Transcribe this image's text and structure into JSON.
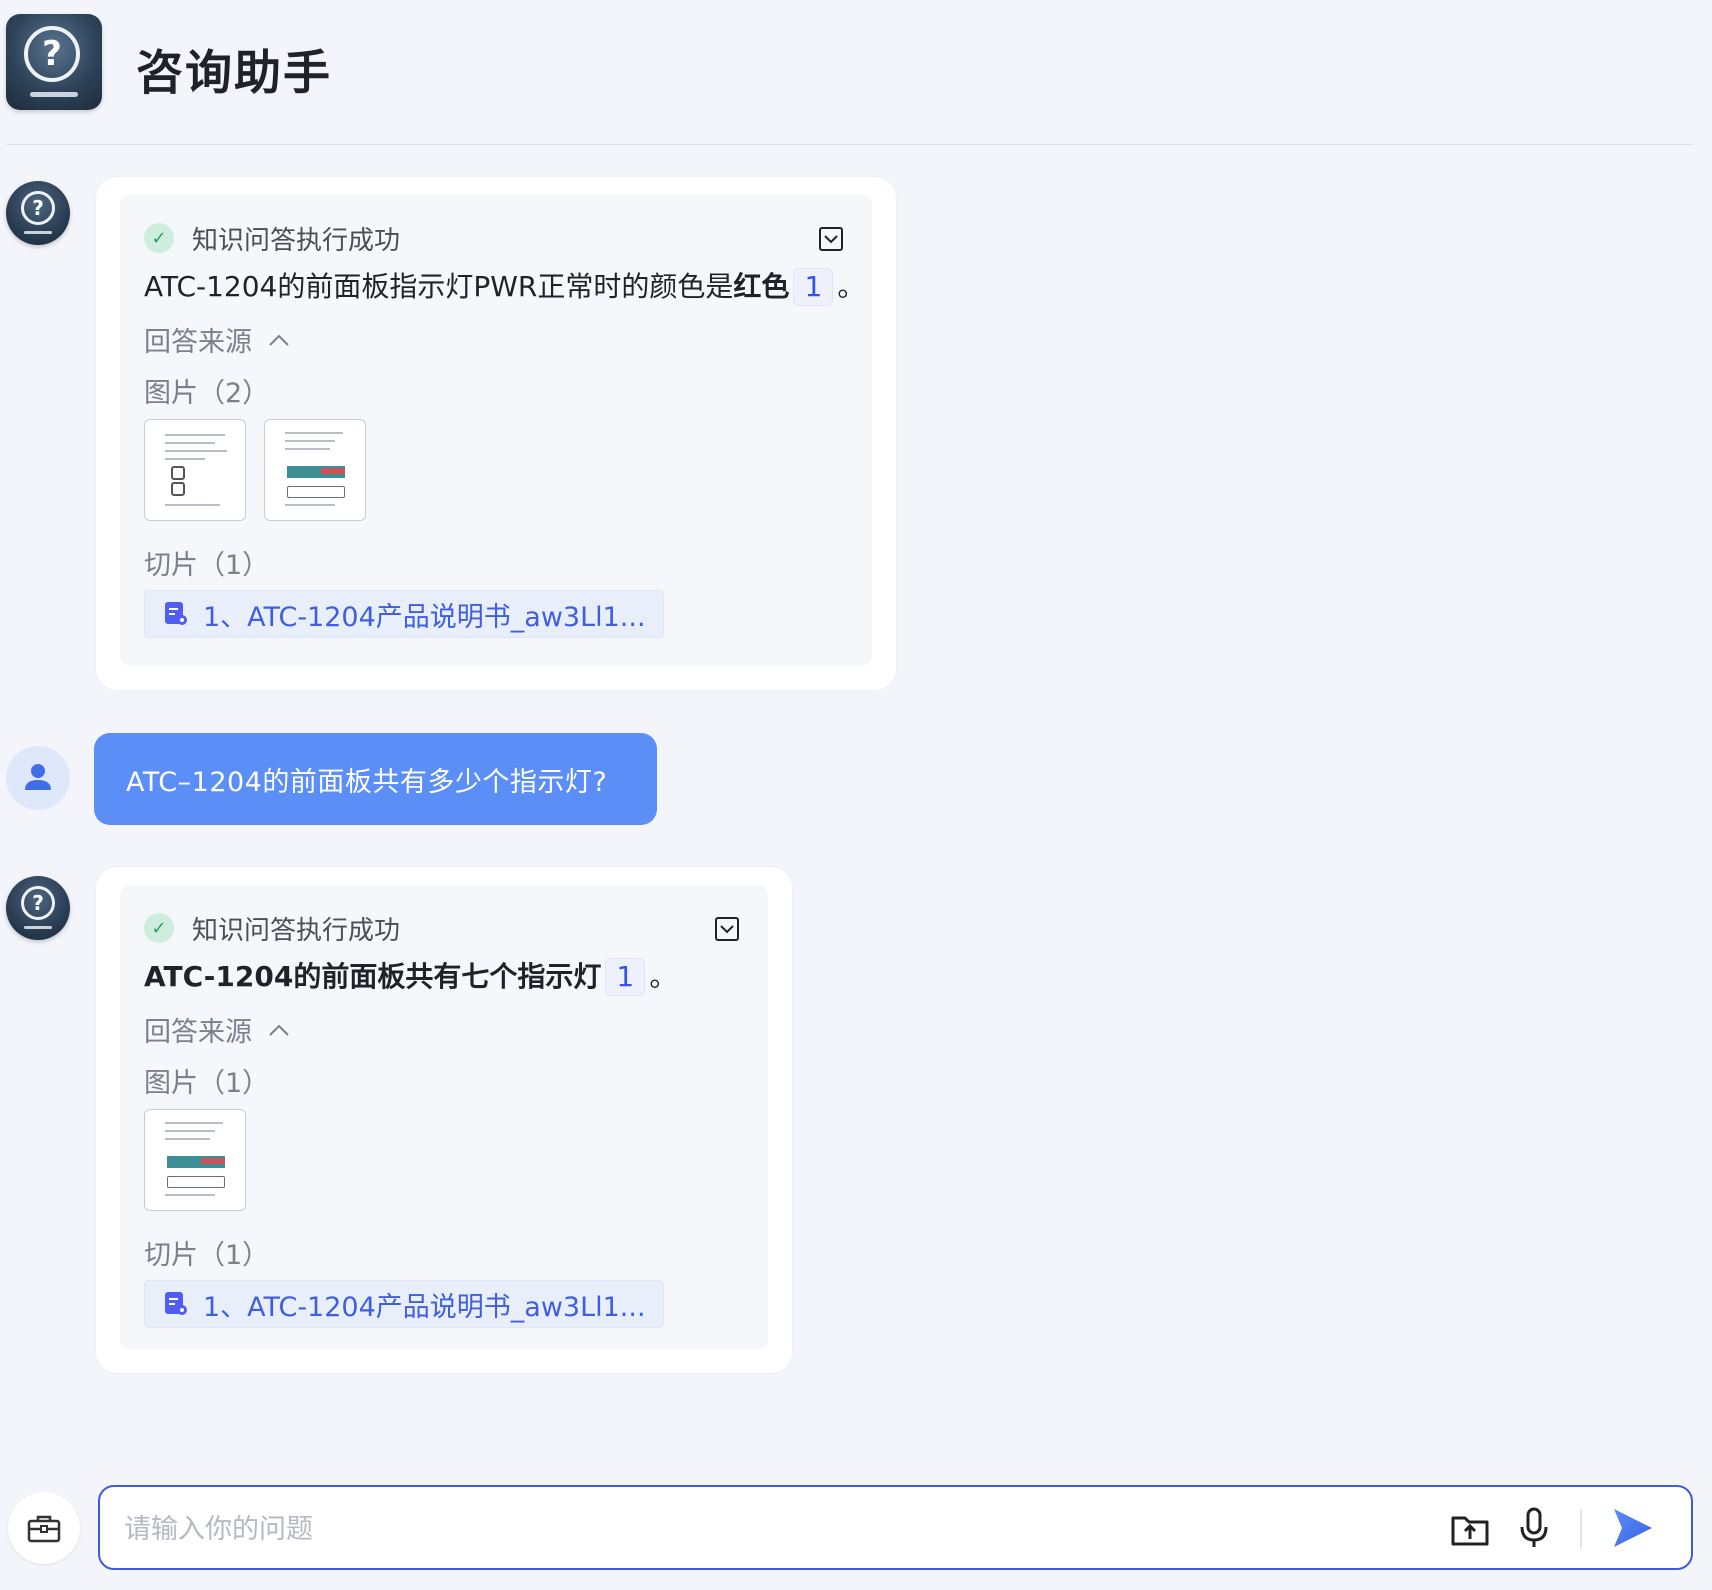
{
  "header": {
    "title": "咨询助手"
  },
  "messages": [
    {
      "role": "bot",
      "status": "知识问答执行成功",
      "answer_prefix": "ATC-1204的前面板指示灯PWR正常时的颜色是",
      "answer_bold": "红色",
      "ref_number": "1",
      "answer_suffix": "。",
      "source_label": "回答来源",
      "images_label": "图片（2）",
      "slices_label": "切片（1）",
      "slice_item": "1、ATC-1204产品说明书_aw3Ll1..."
    },
    {
      "role": "user",
      "text": "ATC–1204的前面板共有多少个指示灯?"
    },
    {
      "role": "bot",
      "status": "知识问答执行成功",
      "answer_bold": "ATC-1204的前面板共有七个指示灯",
      "ref_number": "1",
      "answer_suffix": "。",
      "source_label": "回答来源",
      "images_label": "图片（1）",
      "slices_label": "切片（1）",
      "slice_item": "1、ATC-1204产品说明书_aw3Ll1..."
    }
  ],
  "input": {
    "placeholder": "请输入你的问题",
    "value": ""
  },
  "icons": {
    "logo": "question-mark-icon",
    "check": "check-circle-icon",
    "collapse": "collapse-square-icon",
    "chevron": "chevron-up-icon",
    "document": "document-search-icon",
    "user": "user-icon",
    "toolbox": "toolbox-icon",
    "upload": "folder-upload-icon",
    "mic": "microphone-icon",
    "send": "send-icon"
  },
  "colors": {
    "background": "#f3f5fa",
    "user_bubble": "#5b8ef6",
    "accent": "#3d5bdb",
    "success": "#2f9e6a",
    "link": "#3f5fe0"
  }
}
